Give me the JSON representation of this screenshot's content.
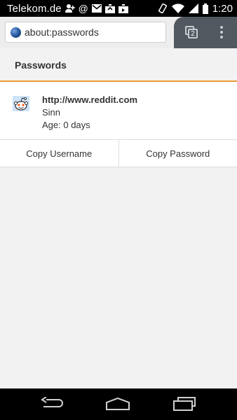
{
  "status_bar": {
    "carrier": "Telekom.de",
    "time": "1:20",
    "icons": [
      "add-person-icon",
      "at-icon",
      "mail-icon",
      "photo-upload-icon",
      "photo-upload-icon",
      "vibrate-icon",
      "wifi-icon",
      "signal-icon",
      "battery-icon"
    ]
  },
  "toolbar": {
    "url": "about:passwords",
    "tab_count": "2"
  },
  "page": {
    "title": "Passwords"
  },
  "entry": {
    "site": "http://www.reddit.com",
    "username": "Sinn",
    "age": "Age: 0 days",
    "favicon": "reddit-alien-icon"
  },
  "actions": {
    "copy_username": "Copy Username",
    "copy_password": "Copy Password"
  },
  "colors": {
    "accent": "#e79a34",
    "status_bar": "#000000",
    "tabs_area": "#525860"
  },
  "nav_bar": {
    "icons": [
      "back-icon",
      "home-icon",
      "recents-icon"
    ]
  }
}
